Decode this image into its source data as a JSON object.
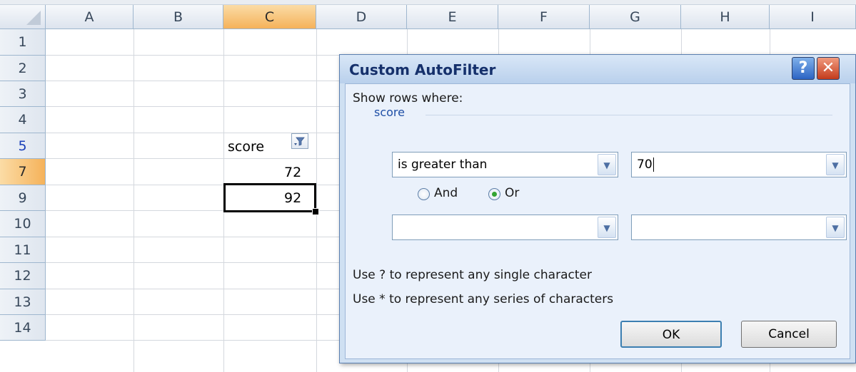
{
  "sheet": {
    "columns": [
      "A",
      "B",
      "C",
      "D",
      "E",
      "F",
      "G",
      "H",
      "I"
    ],
    "rows": [
      "1",
      "2",
      "3",
      "4",
      "5",
      "7",
      "9",
      "10",
      "11",
      "12",
      "13",
      "14"
    ],
    "cells": {
      "header_score": "score",
      "c5": "72",
      "c7": "92"
    },
    "filter_icon": "filter-funnel-icon"
  },
  "dialog": {
    "title": "Custom AutoFilter",
    "help_glyph": "?",
    "close_glyph": "✕",
    "show_rows_label": "Show rows where:",
    "field_name": "score",
    "condition1": {
      "operator": "is greater than",
      "value": "70"
    },
    "logic": {
      "and_label": "And",
      "or_label": "Or",
      "selected": "Or"
    },
    "condition2": {
      "operator": "",
      "value": ""
    },
    "hint1": "Use ? to represent any single character",
    "hint2": "Use * to represent any series of characters",
    "ok_label": "OK",
    "cancel_label": "Cancel"
  },
  "colors": {
    "selected_header": "#f5b25a",
    "dialog_bg": "#cfe0f2",
    "title_text": "#15306b"
  }
}
